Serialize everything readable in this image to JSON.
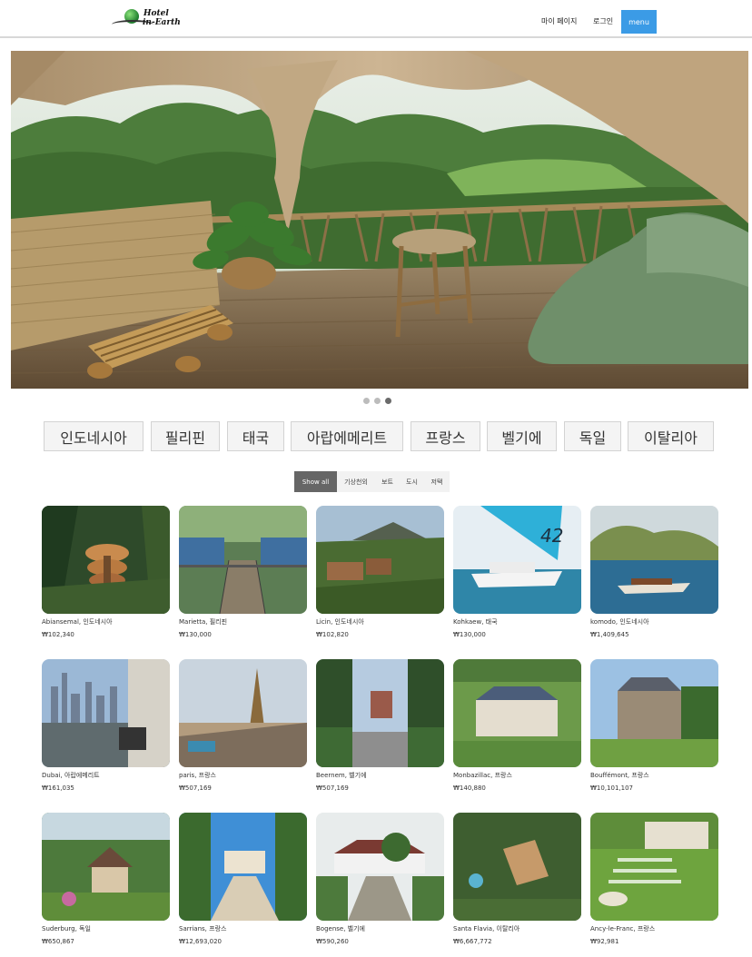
{
  "header": {
    "logo_text_line1": "Hotel",
    "logo_text_line2": "in-Earth",
    "nav": {
      "mypage": "마이 페이지",
      "login": "로그인",
      "menu": "menu"
    }
  },
  "hero": {
    "slide_count": 3,
    "active_slide": 3
  },
  "countries": [
    "인도네시아",
    "필리핀",
    "태국",
    "아랍에메리트",
    "프랑스",
    "벨기에",
    "독일",
    "이탈리아"
  ],
  "filters": {
    "tabs": [
      "Show all",
      "기상천외",
      "보트",
      "도시",
      "저택"
    ],
    "active": "Show all"
  },
  "listings": [
    {
      "name": "Abiansemal, 인도네시아",
      "price": "₩102,340",
      "scene": "jungle-mushroom"
    },
    {
      "name": "Marietta, 필리핀",
      "price": "₩130,000",
      "scene": "treehouse-bridge"
    },
    {
      "name": "Licin, 인도네시아",
      "price": "₩102,820",
      "scene": "volcano-village"
    },
    {
      "name": "Kohkaew, 태국",
      "price": "₩130,000",
      "scene": "catamaran"
    },
    {
      "name": "komodo, 인도네시아",
      "price": "₩1,409,645",
      "scene": "boat-lake"
    },
    {
      "name": "Dubai, 아랍에메리트",
      "price": "₩161,035",
      "scene": "dubai-balcony"
    },
    {
      "name": "paris, 프랑스",
      "price": "₩507,169",
      "scene": "eiffel"
    },
    {
      "name": "Beernem, 벨기에",
      "price": "₩507,169",
      "scene": "castle-avenue"
    },
    {
      "name": "Monbazillac, 프랑스",
      "price": "₩140,880",
      "scene": "chateau-blue"
    },
    {
      "name": "Bouffémont, 프랑스",
      "price": "₩10,101,107",
      "scene": "manor-lawn"
    },
    {
      "name": "Suderburg, 독일",
      "price": "₩650,867",
      "scene": "cottage-garden"
    },
    {
      "name": "Sarrians, 프랑스",
      "price": "₩12,693,020",
      "scene": "chateau-path"
    },
    {
      "name": "Bogense, 벨기에",
      "price": "₩590,260",
      "scene": "gate-path"
    },
    {
      "name": "Santa Flavia, 이탈리아",
      "price": "₩6,667,772",
      "scene": "aerial-villa"
    },
    {
      "name": "Ancy-le-Franc, 프랑스",
      "price": "₩92,981",
      "scene": "formal-garden"
    }
  ]
}
